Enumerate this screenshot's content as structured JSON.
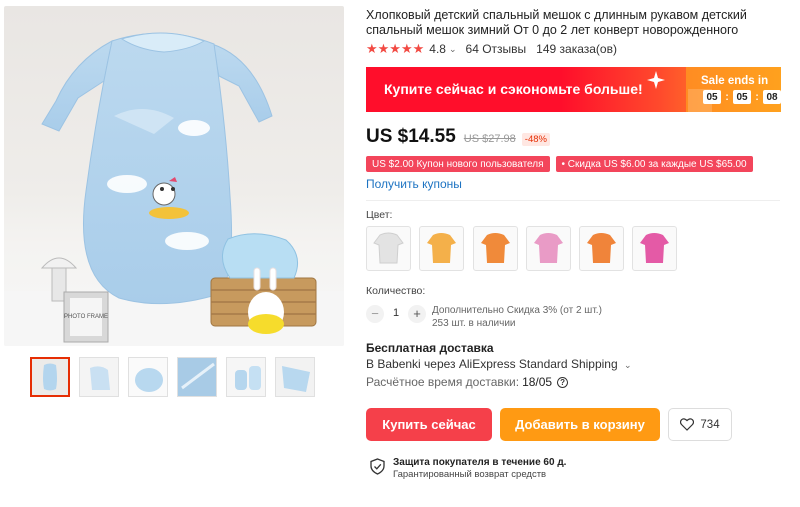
{
  "product": {
    "title": "Хлопковый детский спальный мешок с длинным рукавом детский спальный мешок зимний От 0 до 2 лет конверт новорожденного",
    "image_photo_label": "PHOTO FRAME",
    "rating": "4.8",
    "reviews": "64 Отзывы",
    "orders": "149 заказа(ов)"
  },
  "promo": {
    "text": "Купите сейчас и сэкономьте больше!",
    "sale_title": "Sale ends in",
    "timer": [
      "05",
      "05",
      "08"
    ]
  },
  "price": {
    "current": "US $14.55",
    "old": "US $27.98",
    "discount": "-48%"
  },
  "coupons": {
    "items": [
      "US $2.00 Купон нового пользователя",
      "• Скидка US $6.00 за каждые US $65.00"
    ],
    "get_link": "Получить купоны"
  },
  "variants": {
    "label": "Цвет:",
    "swatch_colors": [
      "#e8e8e8",
      "#f4b04a",
      "#f08a3a",
      "#e99bc6",
      "#f0843a",
      "#e45aa6"
    ]
  },
  "quantity": {
    "label": "Количество:",
    "value": "1",
    "minus": "−",
    "plus": "+",
    "info_1": "Дополнительно Скидка 3% (от 2 шт.)",
    "info_2": "253 шт. в наличии"
  },
  "shipping": {
    "title": "Бесплатная доставка",
    "line": "В Babenki через AliExpress Standard Shipping",
    "delivery_label": "Расчётное время доставки:",
    "delivery_date": "18/05",
    "help": "?"
  },
  "actions": {
    "buy": "Купить сейчас",
    "cart": "Добавить в корзину",
    "wishlist_count": "734"
  },
  "protection": {
    "title": "Защита покупателя в течение 60 д.",
    "subtitle": "Гарантированный возврат средств"
  },
  "colors": {
    "accent_red": "#f5404a",
    "accent_orange": "#ff9a13",
    "link_blue": "#1d73c2"
  }
}
